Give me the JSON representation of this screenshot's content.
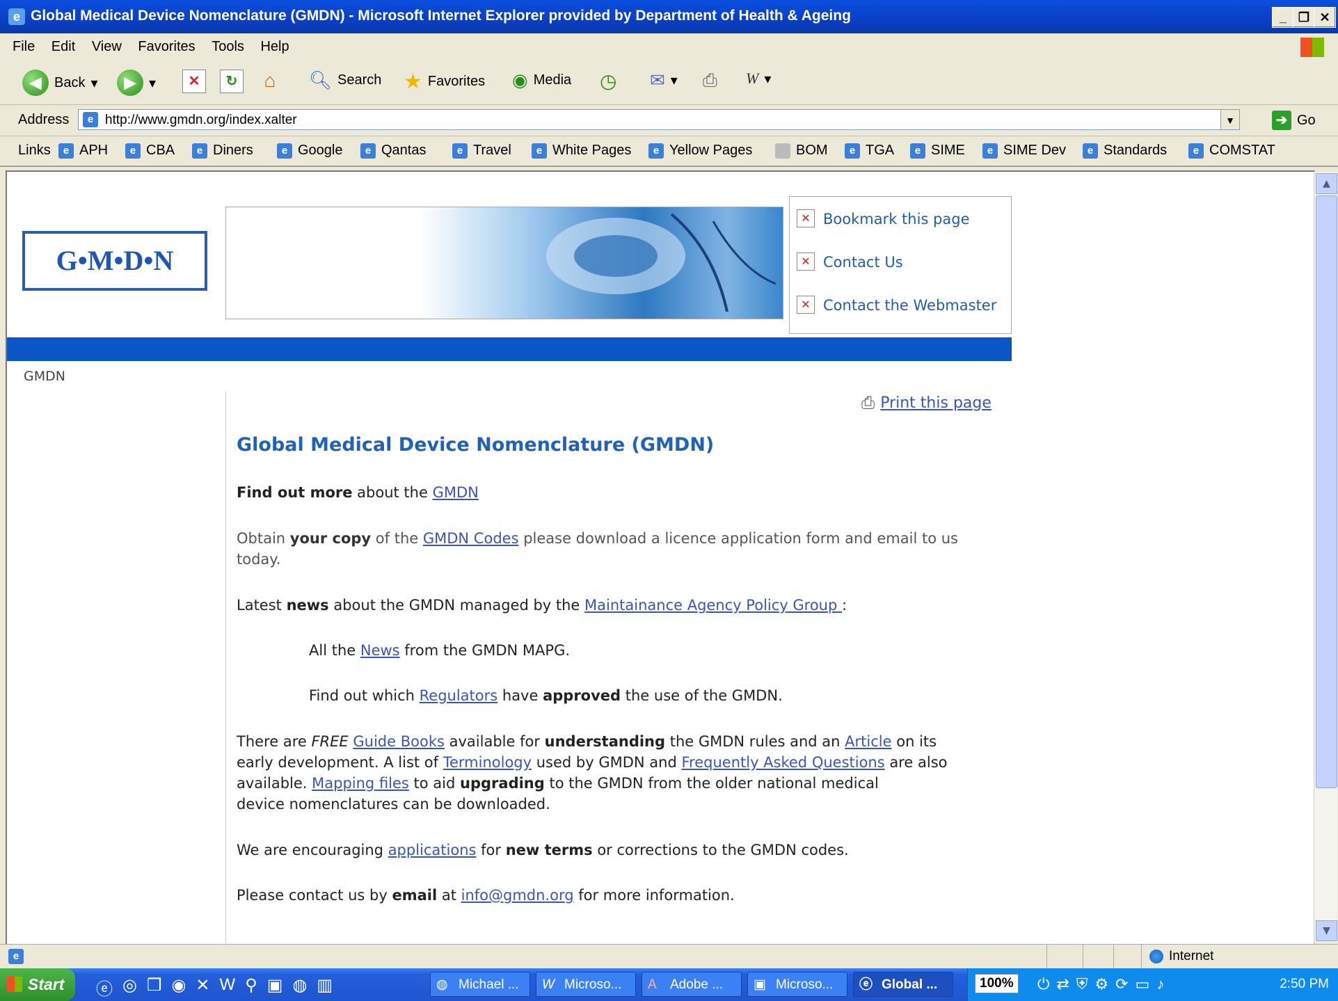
{
  "window": {
    "title": "Global Medical Device Nomenclature (GMDN) - Microsoft Internet Explorer provided by Department of Health & Ageing"
  },
  "menu": [
    "File",
    "Edit",
    "View",
    "Favorites",
    "Tools",
    "Help"
  ],
  "toolbar": {
    "back": "Back",
    "search": "Search",
    "favorites": "Favorites",
    "media": "Media"
  },
  "address": {
    "label": "Address",
    "url": "http://www.gmdn.org/index.xalter",
    "go": "Go"
  },
  "links": {
    "label": "Links",
    "items": [
      "APH",
      "CBA",
      "Diners",
      "Google",
      "Qantas",
      "Travel",
      "White Pages",
      "Yellow Pages",
      "BOM",
      "TGA",
      "SIME",
      "SIME Dev",
      "Standards",
      "COMSTAT"
    ]
  },
  "page": {
    "logo": "G•M•D•N",
    "side_links": [
      "Bookmark this page",
      "Contact Us",
      "Contact the Webmaster"
    ],
    "breadcrumb": "GMDN",
    "print": "Print this page",
    "heading": "Global Medical Device Nomenclature (GMDN)",
    "p1": {
      "b": "Find out more",
      "t1": " about the ",
      "a": "GMDN"
    },
    "p2": {
      "t1": "Obtain ",
      "b": "your copy",
      "t2": " of the ",
      "a": "GMDN Codes",
      "t3": "  please download a licence application form and email to us",
      "t4": "today."
    },
    "p3": {
      "t1": "Latest ",
      "b": "news",
      "t2": " about the GMDN managed by the ",
      "a": "Maintainance Agency Policy Group ",
      "t3": ":"
    },
    "p4": {
      "t1": "All the ",
      "a": "News",
      "t2": "   from the GMDN MAPG."
    },
    "p5": {
      "t1": "Find out which ",
      "a": "Regulators",
      "t2": " have ",
      "b": "approved",
      "t3": " the use of the GMDN."
    },
    "p6": {
      "t1": "There are ",
      "i": "FREE",
      "a1": "Guide Books",
      "t2": " available for ",
      "b1": "understanding",
      "t3": " the GMDN rules and an ",
      "a2": "Article",
      "t4": " on its",
      "t5": "early development. A list of ",
      "a3": "Terminology",
      "t6": " used by GMDN and ",
      "a4": "Frequently Asked Questions",
      "t7": " are also",
      "t8": "available. ",
      "a5": "Mapping files",
      "t9": " to aid ",
      "b2": "upgrading",
      "t10": " to the GMDN from the older national medical",
      "t11": "device nomenclatures can be downloaded."
    },
    "p7": {
      "t1": "We are encouraging ",
      "a": "applications",
      "t2": " for ",
      "b": "new terms",
      "t3": "  or corrections to the GMDN codes."
    },
    "p8": {
      "t1": "Please contact us by ",
      "b": "email",
      "t2": " at ",
      "a": "info@gmdn.org",
      "t3": " for more information."
    }
  },
  "status": {
    "zone": "Internet"
  },
  "taskbar": {
    "start": "Start",
    "tasks": [
      "Michael ...",
      "Microso...",
      "Adobe ...",
      "Microso...",
      "Global ..."
    ],
    "zoom": "100%",
    "clock": "2:50 PM"
  }
}
